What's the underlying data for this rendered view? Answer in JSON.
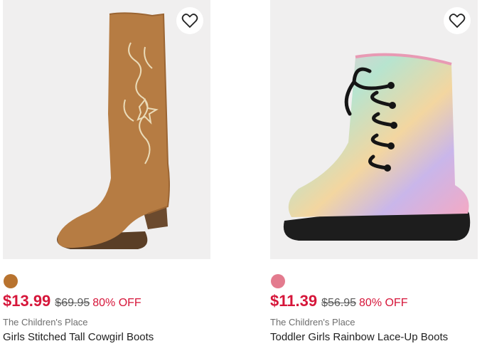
{
  "products": [
    {
      "price": "$13.99",
      "was_price": "$69.95",
      "discount": "80% OFF",
      "brand": "The Children's Place",
      "name": "Girls Stitched Tall Cowgirl Boots",
      "swatch_color": "#b8732f",
      "image_icon": "cowgirl-boot-image"
    },
    {
      "price": "$11.39",
      "was_price": "$56.95",
      "discount": "80% OFF",
      "brand": "The Children's Place",
      "name": "Toddler Girls Rainbow Lace-Up Boots",
      "swatch_color": "#e37b8e",
      "image_icon": "rainbow-boot-image"
    }
  ],
  "colors": {
    "sale_red": "#d6163a",
    "image_bg": "#f0efef"
  }
}
